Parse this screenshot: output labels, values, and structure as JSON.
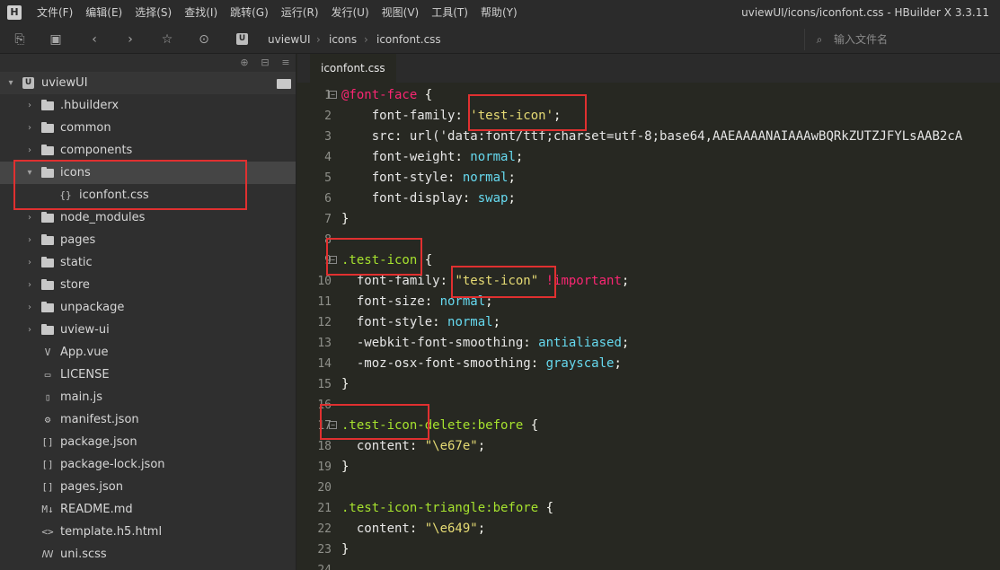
{
  "menubar": {
    "logo": "H",
    "items": [
      "文件(F)",
      "编辑(E)",
      "选择(S)",
      "查找(I)",
      "跳转(G)",
      "运行(R)",
      "发行(U)",
      "视图(V)",
      "工具(T)",
      "帮助(Y)"
    ],
    "window_title": "uviewUI/icons/iconfont.css - HBuilder X 3.3.11"
  },
  "toolbar": {
    "breadcrumb": [
      "uviewUI",
      "icons",
      "iconfont.css"
    ],
    "file_search_placeholder": "输入文件名"
  },
  "sidebar": {
    "root": {
      "label": "uviewUI",
      "logo": "U"
    },
    "items": [
      {
        "label": ".hbuilderx",
        "type": "folder"
      },
      {
        "label": "common",
        "type": "folder"
      },
      {
        "label": "components",
        "type": "folder"
      },
      {
        "label": "icons",
        "type": "folder-open"
      },
      {
        "label": "iconfont.css",
        "type": "css",
        "glyph": "{}"
      },
      {
        "label": "node_modules",
        "type": "folder"
      },
      {
        "label": "pages",
        "type": "folder"
      },
      {
        "label": "static",
        "type": "folder"
      },
      {
        "label": "store",
        "type": "folder"
      },
      {
        "label": "unpackage",
        "type": "folder"
      },
      {
        "label": "uview-ui",
        "type": "folder"
      },
      {
        "label": "App.vue",
        "type": "file",
        "glyph": "V"
      },
      {
        "label": "LICENSE",
        "type": "file",
        "glyph": "▭"
      },
      {
        "label": "main.js",
        "type": "file",
        "glyph": "▯"
      },
      {
        "label": "manifest.json",
        "type": "file",
        "glyph": "⚙"
      },
      {
        "label": "package.json",
        "type": "file",
        "glyph": "[]"
      },
      {
        "label": "package-lock.json",
        "type": "file",
        "glyph": "[]"
      },
      {
        "label": "pages.json",
        "type": "file",
        "glyph": "[]"
      },
      {
        "label": "README.md",
        "type": "file",
        "glyph": "M↓"
      },
      {
        "label": "template.h5.html",
        "type": "file",
        "glyph": "<>"
      },
      {
        "label": "uni.scss",
        "type": "file",
        "glyph": "ꟿ"
      }
    ]
  },
  "editor": {
    "tab_label": "iconfont.css",
    "line_numbers": [
      "1",
      "2",
      "3",
      "4",
      "5",
      "6",
      "7",
      "8",
      "9",
      "10",
      "11",
      "12",
      "13",
      "14",
      "15",
      "16",
      "17",
      "18",
      "19",
      "20",
      "21",
      "22",
      "23",
      "24"
    ],
    "code": {
      "l1_at": "@font-face",
      "l1_brace": " {",
      "l2_prop": "    font-family",
      "l2_colon": ": ",
      "l2_str": "'test-icon'",
      "l2_end": ";",
      "l3_prop": "    src",
      "l3_colon": ": ",
      "l3_val": "url('data:font/ttf;charset=utf-8;base64,AAEAAAANAIAAAwBQRkZUTZJFYLsAAB2cA",
      "l4_prop": "    font-weight",
      "l4_colon": ": ",
      "l4_val": "normal",
      "l4_end": ";",
      "l5_prop": "    font-style",
      "l5_colon": ": ",
      "l5_val": "normal",
      "l5_end": ";",
      "l6_prop": "    font-display",
      "l6_colon": ": ",
      "l6_val": "swap",
      "l6_end": ";",
      "l7": "}",
      "l9_sel": ".test-icon",
      "l9_brace": " {",
      "l10_prop": "  font-family",
      "l10_colon": ": ",
      "l10_str": "\"test-icon\"",
      "l10_imp": " !important",
      "l10_end": ";",
      "l11_prop": "  font-size",
      "l11_colon": ": ",
      "l11_val": "normal",
      "l11_end": ";",
      "l12_prop": "  font-style",
      "l12_colon": ": ",
      "l12_val": "normal",
      "l12_end": ";",
      "l13_prop": "  -webkit-font-smoothing",
      "l13_colon": ": ",
      "l13_val": "antialiased",
      "l13_end": ";",
      "l14_prop": "  -moz-osx-font-smoothing",
      "l14_colon": ": ",
      "l14_val": "grayscale",
      "l14_end": ";",
      "l15": "}",
      "l17_sel": ".test-icon-delete:before",
      "l17_brace": " {",
      "l18_prop": "  content",
      "l18_colon": ": ",
      "l18_str": "\"\\e67e\"",
      "l18_end": ";",
      "l19": "}",
      "l21_sel": ".test-icon-triangle:before",
      "l21_brace": " {",
      "l22_prop": "  content",
      "l22_colon": ": ",
      "l22_str": "\"\\e649\"",
      "l22_end": ";",
      "l23": "}"
    }
  },
  "colors": {
    "annotation_red": "#e03030",
    "editor_bg": "#272822",
    "sidebar_bg": "#2f2f2f"
  }
}
